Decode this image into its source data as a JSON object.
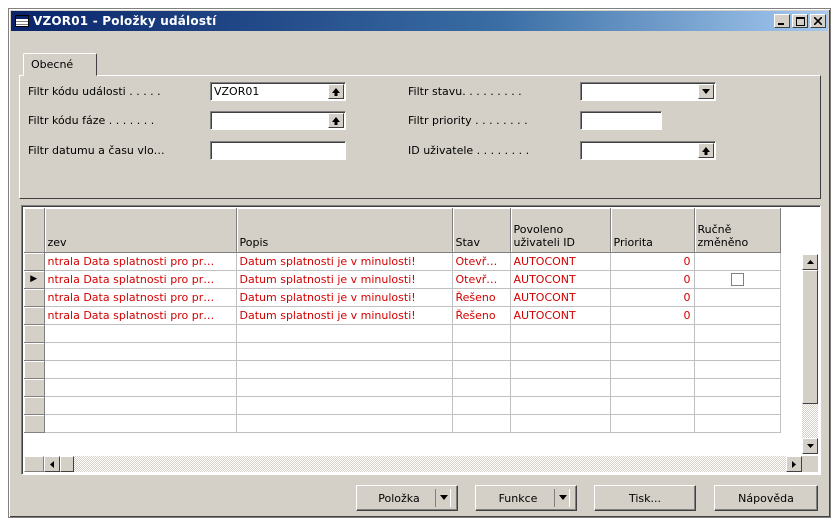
{
  "window": {
    "title": "VZOR01 - Položky událostí",
    "controls": {
      "minimize": "▁",
      "maximize": "□",
      "close": "✕"
    }
  },
  "tabs": [
    {
      "label": "Obecné",
      "active": true
    }
  ],
  "filters": {
    "left": [
      {
        "label": "Filtr kódu události . . . . .",
        "value": "VZOR01",
        "lookup_icon": "lookup-arrow-up-icon"
      },
      {
        "label": "Filtr kódu fáze . . . . . . .",
        "value": "",
        "lookup_icon": "lookup-arrow-up-icon"
      },
      {
        "label": "Filtr datumu a času vlo…",
        "value": ""
      }
    ],
    "right": [
      {
        "label": "Filtr stavu. . . . . . . . .",
        "value": "",
        "dropdown_icon": "chevron-down-icon"
      },
      {
        "label": "Filtr priority . . . . . . . .",
        "value": ""
      },
      {
        "label": "ID uživatele . . . . . . . .",
        "value": "",
        "lookup_icon": "lookup-arrow-up-icon"
      }
    ]
  },
  "grid": {
    "columns": [
      {
        "label": "zev"
      },
      {
        "label": "Popis"
      },
      {
        "label": "Stav"
      },
      {
        "label": "Povoleno uživateli ID"
      },
      {
        "label": "Priorita"
      },
      {
        "label": "Ručně změněno"
      }
    ],
    "rows": [
      {
        "name": "ntrala Data splatnosti pro pr…",
        "description": "Datum splatnosti je v minulosti!",
        "status": "Otevř…",
        "allowed_user": "AUTOCONT",
        "priority": "0",
        "manual": "",
        "current": false
      },
      {
        "name": "ntrala Data splatnosti pro pr…",
        "description": "Datum splatnosti je v minulosti!",
        "status": "Otevř…",
        "allowed_user": "AUTOCONT",
        "priority": "0",
        "manual": "checkbox",
        "current": true
      },
      {
        "name": "ntrala Data splatnosti pro pr…",
        "description": "Datum splatnosti je v minulosti!",
        "status": "Řešeno",
        "allowed_user": "AUTOCONT",
        "priority": "0",
        "manual": "",
        "current": false
      },
      {
        "name": "ntrala Data splatnosti pro pr…",
        "description": "Datum splatnosti je v minulosti!",
        "status": "Řešeno",
        "allowed_user": "AUTOCONT",
        "priority": "0",
        "manual": "",
        "current": false
      }
    ],
    "empty_rows": 6,
    "current_row_marker": "▶",
    "text_color": "#d40000"
  },
  "buttons": [
    {
      "label": "Položka",
      "has_dropdown": true
    },
    {
      "label": "Funkce",
      "has_dropdown": true
    },
    {
      "label": "Tisk...",
      "has_dropdown": false
    },
    {
      "label": "Nápověda",
      "has_dropdown": false
    }
  ],
  "colors": {
    "titlebar_start": "#0a246a",
    "titlebar_end": "#a6caf0",
    "face": "#d4d0c8"
  }
}
